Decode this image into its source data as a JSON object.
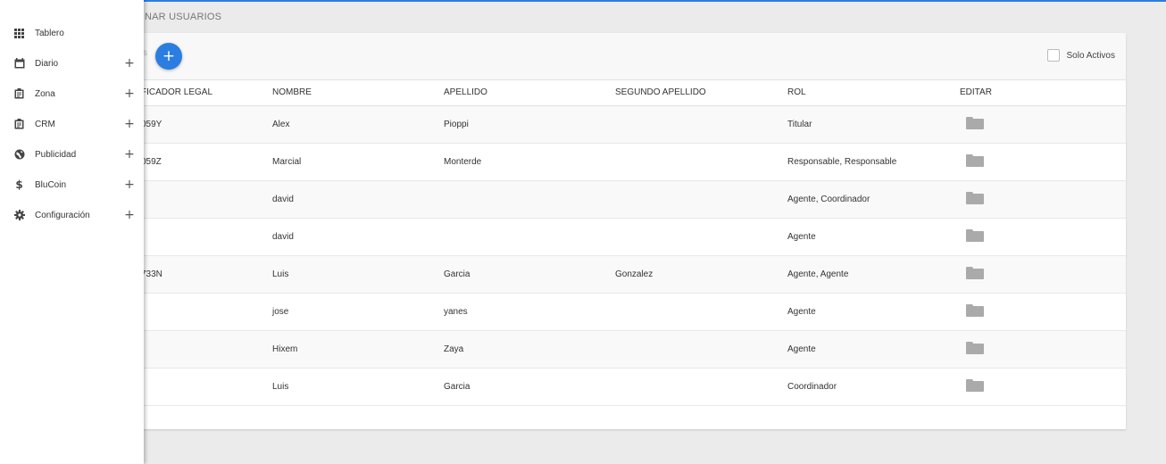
{
  "page": {
    "title": "NAR USUARIOS"
  },
  "card": {
    "head_label": "s",
    "add_icon": "plus-icon",
    "filter_label": "Solo Activos",
    "filter_checked": false
  },
  "table": {
    "headers": [
      "FICADOR LEGAL",
      "NOMBRE",
      "APELLIDO",
      "SEGUNDO APELLIDO",
      "ROL",
      "EDITAR"
    ],
    "rows": [
      {
        "id": "059Y",
        "nombre": "Alex",
        "apellido": "Pioppi",
        "segundo": "",
        "rol": "Titular"
      },
      {
        "id": "059Z",
        "nombre": "Marcial",
        "apellido": "Monterde",
        "segundo": "",
        "rol": "Responsable, Responsable"
      },
      {
        "id": "",
        "nombre": "david",
        "apellido": "",
        "segundo": "",
        "rol": "Agente, Coordinador"
      },
      {
        "id": "",
        "nombre": "david",
        "apellido": "",
        "segundo": "",
        "rol": "Agente"
      },
      {
        "id": "733N",
        "nombre": "Luis",
        "apellido": "Garcia",
        "segundo": "Gonzalez",
        "rol": "Agente, Agente"
      },
      {
        "id": "",
        "nombre": "jose",
        "apellido": "yanes",
        "segundo": "",
        "rol": "Agente"
      },
      {
        "id": "",
        "nombre": "Hixem",
        "apellido": "Zaya",
        "segundo": "",
        "rol": "Agente"
      },
      {
        "id": "",
        "nombre": "Luis",
        "apellido": "Garcia",
        "segundo": "",
        "rol": "Coordinador"
      }
    ],
    "edit_icon": "folder-icon"
  },
  "sidebar": {
    "items": [
      {
        "label": "Tablero",
        "icon": "grid-icon",
        "expandable": false
      },
      {
        "label": "Diario",
        "icon": "calendar-icon",
        "expandable": true
      },
      {
        "label": "Zona",
        "icon": "clipboard-icon",
        "expandable": true
      },
      {
        "label": "CRM",
        "icon": "clipboard-icon",
        "expandable": true
      },
      {
        "label": "Publicidad",
        "icon": "globe-icon",
        "expandable": true
      },
      {
        "label": "BluCoin",
        "icon": "dollar-icon",
        "expandable": true
      },
      {
        "label": "Configuración",
        "icon": "gear-icon",
        "expandable": true
      }
    ],
    "expand_glyph": "+"
  },
  "colors": {
    "accent": "#2b7de1",
    "background": "#ebebeb",
    "folder": "#aaaaaa"
  }
}
